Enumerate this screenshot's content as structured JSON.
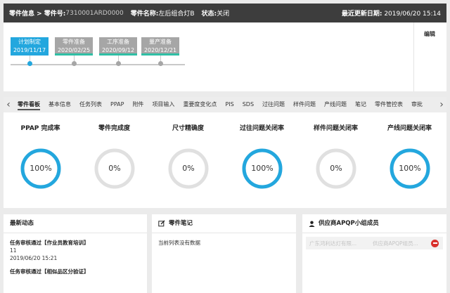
{
  "header": {
    "part_info_label": "零件信息 > 零件号:",
    "part_number": "7310001ARD0000",
    "part_name_label": "零件名称:",
    "part_name": "左后组合灯B",
    "status_label": "状态:",
    "status": "关闭",
    "updated_label": "最近更新日期:",
    "updated_value": "2019/06/20 15:14"
  },
  "timeline": {
    "milestones": [
      {
        "name": "计划制定",
        "date": "2019/11/17",
        "state": "active"
      },
      {
        "name": "零件准备",
        "date": "2020/02/25",
        "state": "done"
      },
      {
        "name": "工序准备",
        "date": "2020/09/12",
        "state": "done"
      },
      {
        "name": "量产准备",
        "date": "2020/12/21",
        "state": "done"
      }
    ],
    "edit_label": "编辑"
  },
  "tabs": {
    "items": [
      "零件看板",
      "基本信息",
      "任务列表",
      "PPAP",
      "附件",
      "项目输入",
      "重要度变化点",
      "PIS",
      "SDS",
      "过往问题",
      "样件问题",
      "产线问题",
      "笔记",
      "零件管控表",
      "审批"
    ],
    "active_index": 0
  },
  "metrics": [
    {
      "title": "PPAP 完成率",
      "value": "100%",
      "percent": 100
    },
    {
      "title": "零件完成度",
      "value": "0%",
      "percent": 0
    },
    {
      "title": "尺寸精确度",
      "value": "0%",
      "percent": 0
    },
    {
      "title": "过往问题关闭率",
      "value": "100%",
      "percent": 100
    },
    {
      "title": "样件问题关闭率",
      "value": "0%",
      "percent": 0
    },
    {
      "title": "产线问题关闭率",
      "value": "100%",
      "percent": 100
    }
  ],
  "colors": {
    "accent": "#23a7de",
    "ring_empty": "#e0e0e0",
    "header_bg": "#3d3d3d",
    "milestone_done": "#a6a6a6",
    "milestone_bar": "#2fbfa5",
    "remove": "#d9302c"
  },
  "news": {
    "title": "最新动态",
    "items": [
      {
        "title": "任务审核通过【作业员教育培训】",
        "detail": "11",
        "time": "2019/06/20 15:21"
      },
      {
        "title": "任务审核通过【相似品区分验证】",
        "detail": "",
        "time": ""
      }
    ]
  },
  "notes": {
    "title": "零件笔记",
    "empty_text": "当前列表没有数据"
  },
  "members": {
    "title": "供应商APQP小组成员",
    "rows": [
      {
        "company": "广东鸿利达灯有限...",
        "role": "供应商APQP组员..."
      }
    ]
  }
}
